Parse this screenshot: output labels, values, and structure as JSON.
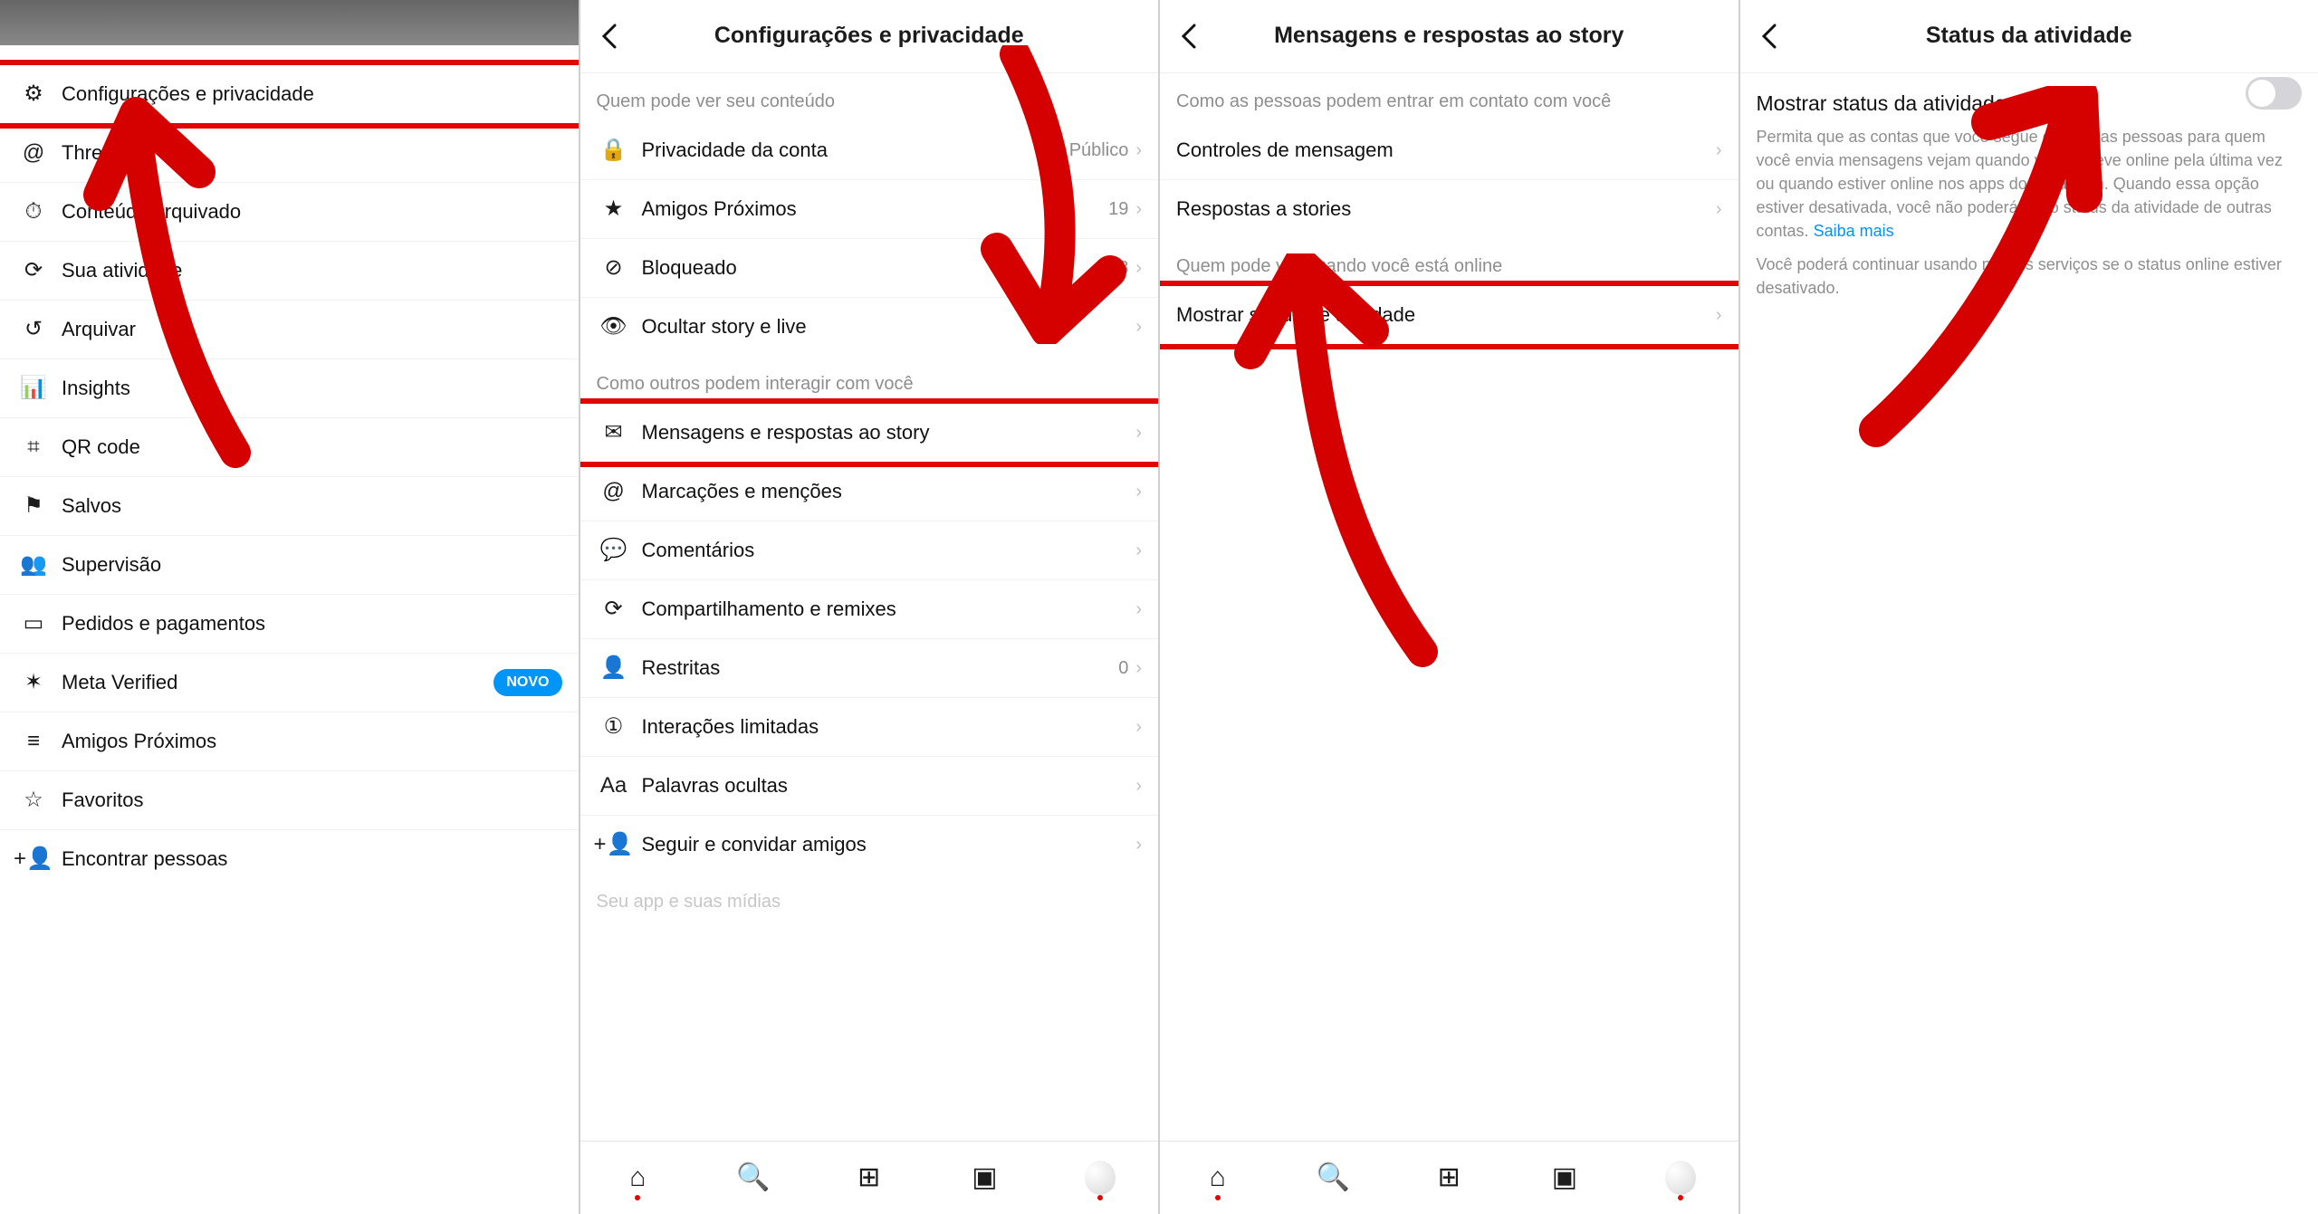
{
  "panel1": {
    "menu": [
      {
        "icon": "⚙",
        "label": "Configurações e privacidade",
        "highlight": true
      },
      {
        "icon": "@",
        "label": "Threads"
      },
      {
        "icon": "⏱",
        "label": "Conteúdo arquivado"
      },
      {
        "icon": "⟳",
        "label": "Sua atividade"
      },
      {
        "icon": "↺",
        "label": "Arquivar"
      },
      {
        "icon": "📊",
        "label": "Insights"
      },
      {
        "icon": "⌗",
        "label": "QR code"
      },
      {
        "icon": "⚑",
        "label": "Salvos"
      },
      {
        "icon": "👥",
        "label": "Supervisão"
      },
      {
        "icon": "▭",
        "label": "Pedidos e pagamentos"
      },
      {
        "icon": "✶",
        "label": "Meta Verified",
        "badge": "NOVO"
      },
      {
        "icon": "≡",
        "label": "Amigos Próximos"
      },
      {
        "icon": "☆",
        "label": "Favoritos"
      },
      {
        "icon": "+👤",
        "label": "Encontrar pessoas"
      }
    ]
  },
  "panel2": {
    "title": "Configurações e privacidade",
    "section_vis": "Quem pode ver seu conteúdo",
    "vis_rows": [
      {
        "icon": "🔒",
        "label": "Privacidade da conta",
        "value": "Público"
      },
      {
        "icon": "★",
        "label": "Amigos Próximos",
        "value": "19"
      },
      {
        "icon": "⊘",
        "label": "Bloqueado",
        "value": "8"
      },
      {
        "icon": "👁",
        "label": "Ocultar story e live"
      }
    ],
    "section_int": "Como outros podem interagir com você",
    "int_rows": [
      {
        "icon": "✉",
        "label": "Mensagens e respostas ao story",
        "highlight": true
      },
      {
        "icon": "@",
        "label": "Marcações e menções"
      },
      {
        "icon": "💬",
        "label": "Comentários"
      },
      {
        "icon": "⟳",
        "label": "Compartilhamento e remixes"
      },
      {
        "icon": "👤",
        "label": "Restritas",
        "value": "0"
      },
      {
        "icon": "①",
        "label": "Interações limitadas"
      },
      {
        "icon": "Aa",
        "label": "Palavras ocultas"
      },
      {
        "icon": "+👤",
        "label": "Seguir e convidar amigos"
      }
    ],
    "section_app": "Seu app e suas mídias"
  },
  "panel3": {
    "title": "Mensagens e respostas ao story",
    "section_contact": "Como as pessoas podem entrar em contato com você",
    "contact_rows": [
      {
        "label": "Controles de mensagem"
      },
      {
        "label": "Respostas a stories"
      }
    ],
    "section_online": "Quem pode ver quando você está online",
    "online_rows": [
      {
        "label": "Mostrar status de atividade",
        "highlight": true
      }
    ]
  },
  "panel4": {
    "title": "Status da atividade",
    "toggle_title": "Mostrar status da atividade",
    "desc": "Permita que as contas que você segue e todas as pessoas para quem você envia mensagens vejam quando você esteve online pela última vez ou quando estiver online nos apps do Instagram. Quando essa opção estiver desativada, você não poderá ver o status da atividade de outras contas.",
    "learn_more": "Saiba mais",
    "note": "Você poderá continuar usando nossos serviços se o status online estiver desativado."
  }
}
